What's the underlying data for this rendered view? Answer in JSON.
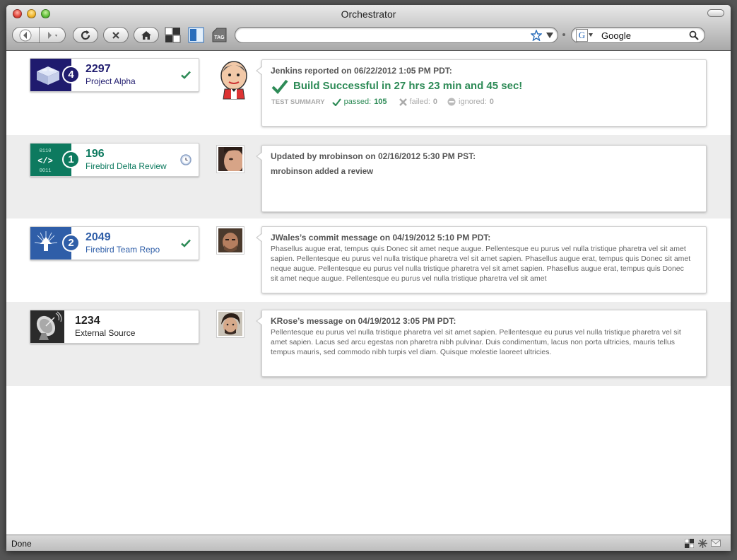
{
  "window": {
    "title": "Orchestrator"
  },
  "search": {
    "placeholder": "Google",
    "value": "Google"
  },
  "status_bar": {
    "text": "Done"
  },
  "feed": [
    {
      "repo": {
        "count": "2297",
        "name": "Project Alpha",
        "badge": "4",
        "status": "success"
      },
      "message": {
        "header": "Jenkins reported on 06/22/2012 1:05 PM PDT:",
        "build_result": "Build Successful in 27 hrs 23 min and 45 sec!",
        "test_summary_label": "TEST SUMMARY",
        "passed_label": "passed:",
        "passed_value": "105",
        "failed_label": "failed:",
        "failed_value": "0",
        "ignored_label": "ignored:",
        "ignored_value": "0"
      }
    },
    {
      "repo": {
        "count": "196",
        "name": "Firebird Delta Review",
        "badge": "1",
        "status": "pending"
      },
      "message": {
        "header": "Updated by mrobinson on 02/16/2012 5:30 PM PST:",
        "body": "mrobinson added a review"
      }
    },
    {
      "repo": {
        "count": "2049",
        "name": "Firebird Team Repo",
        "badge": "2",
        "status": "success"
      },
      "message": {
        "header": "JWales’s commit message on 04/19/2012 5:10 PM PDT:",
        "body": "Phasellus augue erat, tempus quis Donec sit amet neque augue. Pellentesque eu purus vel nulla tristique pharetra vel sit amet sapien. Pellentesque eu purus vel nulla tristique pharetra vel sit amet sapien. Phasellus augue erat, tempus quis Donec sit amet neque augue. Pellentesque eu purus vel nulla tristique pharetra vel sit amet sapien. Phasellus augue erat, tempus quis Donec sit amet neque augue. Pellentesque eu purus vel nulla tristique pharetra vel sit amet"
      }
    },
    {
      "repo": {
        "count": "1234",
        "name": "External Source"
      },
      "message": {
        "header": "KRose’s message on 04/19/2012 3:05 PM PDT:",
        "body": "Pellentesque eu purus vel nulla tristique pharetra vel sit amet sapien. Pellentesque eu purus vel nulla tristique pharetra vel sit amet sapien. Lacus sed arcu egestas non pharetra nibh pulvinar. Duis condimentum, lacus non porta ultricies, mauris tellus tempus mauris, sed commodo nibh turpis vel diam. Quisque molestie laoreet ultricies."
      }
    }
  ],
  "colors": {
    "alpha_accent": "#1f1b6e",
    "review_accent": "#0d7a5f",
    "team_accent": "#2f5ea8",
    "external_accent": "#2b2b2b",
    "success_green": "#2e8b57"
  }
}
